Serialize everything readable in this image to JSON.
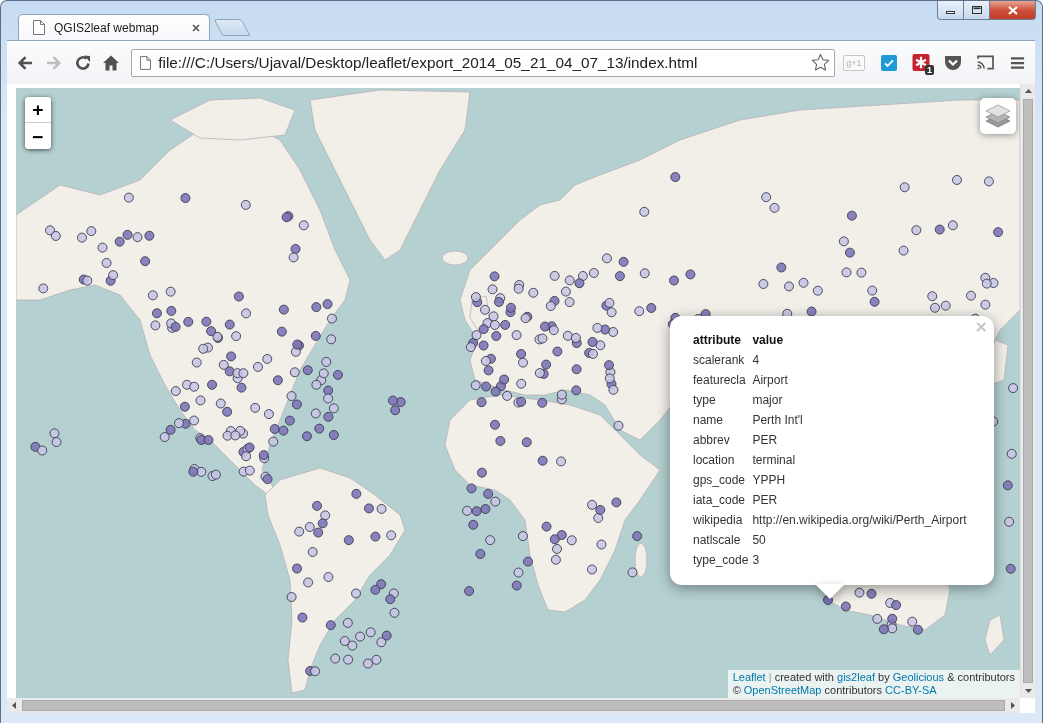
{
  "tabs": [
    {
      "label": "QGIS2leaf webmap",
      "selected": true
    }
  ],
  "toolbar": {
    "nav_buttons": [
      {
        "kind": "back",
        "disabled": false
      },
      {
        "kind": "forward",
        "disabled": true
      },
      {
        "kind": "reload",
        "disabled": false
      },
      {
        "kind": "home",
        "disabled": false
      }
    ],
    "address": "file:///C:/Users/Ujaval/Desktop/leaflet/export_2014_05_21_04_07_13/index.html",
    "bookmarked": false,
    "extensions": [
      {
        "kind": "plus-one",
        "label": "g+1"
      },
      {
        "kind": "check"
      },
      {
        "kind": "asterisk",
        "badge": "1"
      },
      {
        "kind": "pocket"
      },
      {
        "kind": "cast"
      }
    ]
  },
  "map": {
    "zoom_in": "+",
    "zoom_out": "−",
    "popup": {
      "close": "×",
      "header": [
        "attribute",
        "value"
      ],
      "rows": [
        [
          "scalerank",
          "4"
        ],
        [
          "featurecla",
          "Airport"
        ],
        [
          "type",
          "major"
        ],
        [
          "name",
          "Perth Int'l"
        ],
        [
          "abbrev",
          "PER"
        ],
        [
          "location",
          "terminal"
        ],
        [
          "gps_code",
          "YPPH"
        ],
        [
          "iata_code",
          "PER"
        ],
        [
          "wikipedia",
          "http://en.wikipedia.org/wiki/Perth_Airport"
        ],
        [
          "natlscale",
          "50"
        ],
        [
          "type_code",
          "3"
        ]
      ]
    },
    "attribution": [
      [
        {
          "kind": "link",
          "text": "Leaflet"
        },
        {
          "kind": "separator",
          "text": "|"
        },
        {
          "kind": "text",
          "text": "created with"
        },
        {
          "kind": "link",
          "text": "gis2leaf"
        },
        {
          "kind": "text",
          "text": "by"
        },
        {
          "kind": "link",
          "text": "Geolicious"
        },
        {
          "kind": "text",
          "text": "& contributors"
        }
      ],
      [
        {
          "kind": "text",
          "text": "©"
        },
        {
          "kind": "link",
          "text": "OpenStreetMap"
        },
        {
          "kind": "text",
          "text": "contributors"
        },
        {
          "kind": "link",
          "text": "CC-BY-SA"
        }
      ]
    ]
  }
}
